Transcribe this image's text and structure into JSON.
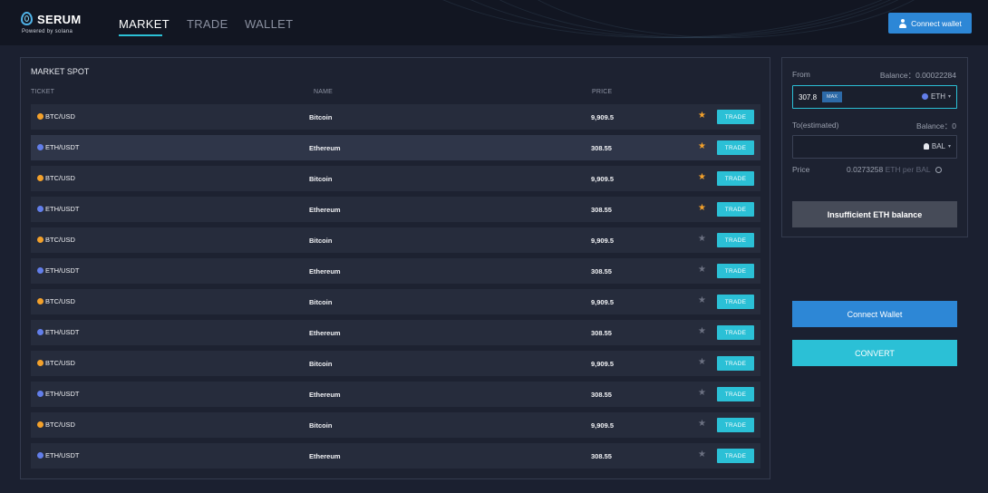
{
  "brand": {
    "name": "SERUM",
    "tagline": "Powered by solana"
  },
  "nav": {
    "tabs": [
      "MARKET",
      "TRADE",
      "WALLET"
    ],
    "active": "MARKET"
  },
  "header": {
    "connect_wallet_label": "Connect wallet"
  },
  "market": {
    "title": "MARKET SPOT",
    "columns": {
      "ticket": "TICKET",
      "name": "NAME",
      "price": "PRICE"
    },
    "trade_label": "TRADE",
    "rows": [
      {
        "ticker": "BTC/USD",
        "coin": "btc",
        "name": "Bitcoin",
        "price": "9,909.5",
        "starred": true,
        "highlighted": false
      },
      {
        "ticker": "ETH/USDT",
        "coin": "eth",
        "name": "Ethereum",
        "price": "308.55",
        "starred": true,
        "highlighted": true
      },
      {
        "ticker": "BTC/USD",
        "coin": "btc",
        "name": "Bitcoin",
        "price": "9,909.5",
        "starred": true,
        "highlighted": false
      },
      {
        "ticker": "ETH/USDT",
        "coin": "eth",
        "name": "Ethereum",
        "price": "308.55",
        "starred": true,
        "highlighted": false
      },
      {
        "ticker": "BTC/USD",
        "coin": "btc",
        "name": "Bitcoin",
        "price": "9,909.5",
        "starred": false,
        "highlighted": false
      },
      {
        "ticker": "ETH/USDT",
        "coin": "eth",
        "name": "Ethereum",
        "price": "308.55",
        "starred": false,
        "highlighted": false
      },
      {
        "ticker": "BTC/USD",
        "coin": "btc",
        "name": "Bitcoin",
        "price": "9,909.5",
        "starred": false,
        "highlighted": false
      },
      {
        "ticker": "ETH/USDT",
        "coin": "eth",
        "name": "Ethereum",
        "price": "308.55",
        "starred": false,
        "highlighted": false
      },
      {
        "ticker": "BTC/USD",
        "coin": "btc",
        "name": "Bitcoin",
        "price": "9,909.5",
        "starred": false,
        "highlighted": false
      },
      {
        "ticker": "ETH/USDT",
        "coin": "eth",
        "name": "Ethereum",
        "price": "308.55",
        "starred": false,
        "highlighted": false
      },
      {
        "ticker": "BTC/USD",
        "coin": "btc",
        "name": "Bitcoin",
        "price": "9,909.5",
        "starred": false,
        "highlighted": false
      },
      {
        "ticker": "ETH/USDT",
        "coin": "eth",
        "name": "Ethereum",
        "price": "308.55",
        "starred": false,
        "highlighted": false
      }
    ]
  },
  "convert": {
    "from_label": "From",
    "from_balance": "Balance：0.00022284",
    "from_amount": "307.8",
    "max_label": "MAX",
    "from_token": "ETH",
    "to_label": "To(estimated)",
    "to_balance": "Balance：0",
    "to_amount": "",
    "to_token": "BAL",
    "price_label": "Price",
    "price_value": "0.0273258",
    "price_unit": "ETH per BAL",
    "insufficient_label": "Insufficient ETH balance"
  },
  "actions": {
    "connect_wallet": "Connect Wallet",
    "convert": "CONVERT"
  },
  "colors": {
    "accent": "#2bc0d6",
    "primary": "#2d87d6",
    "star_on": "#f3a12b",
    "background": "#1b2030"
  },
  "icons": {
    "logo": "serum-logo-icon",
    "user": "user-icon",
    "star": "star-icon",
    "btc": "bitcoin-icon",
    "eth": "ethereum-icon",
    "bal": "balancer-icon",
    "swap": "swap-icon"
  }
}
